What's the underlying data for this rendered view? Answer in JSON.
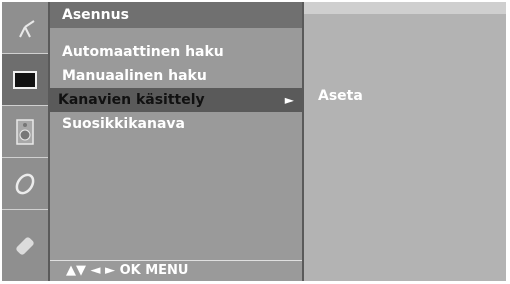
{
  "sidebar": {
    "icons": [
      "antenna-icon",
      "picture-icon",
      "speaker-icon",
      "clock-icon",
      "satellite-icon"
    ],
    "active_index": 1
  },
  "menu": {
    "title": "Asennus",
    "items": [
      {
        "label": "Automaattinen haku"
      },
      {
        "label": "Manuaalinen haku"
      },
      {
        "label": "Kanavien käsittely"
      },
      {
        "label": "Suosikkikanava"
      }
    ],
    "selected_index": 2,
    "submenu_arrow": "►",
    "footer": "▲▼  ◄ ►  OK  MENU"
  },
  "submenu": {
    "items": [
      {
        "label": "Aseta"
      }
    ]
  },
  "colors": {
    "frame": "#5a5a5a",
    "sidebar": "#8f8f8f",
    "menu": "#9a9a9a",
    "submenu": "#b3b3b3",
    "text": "#ffffff",
    "selected_text": "#111111"
  }
}
